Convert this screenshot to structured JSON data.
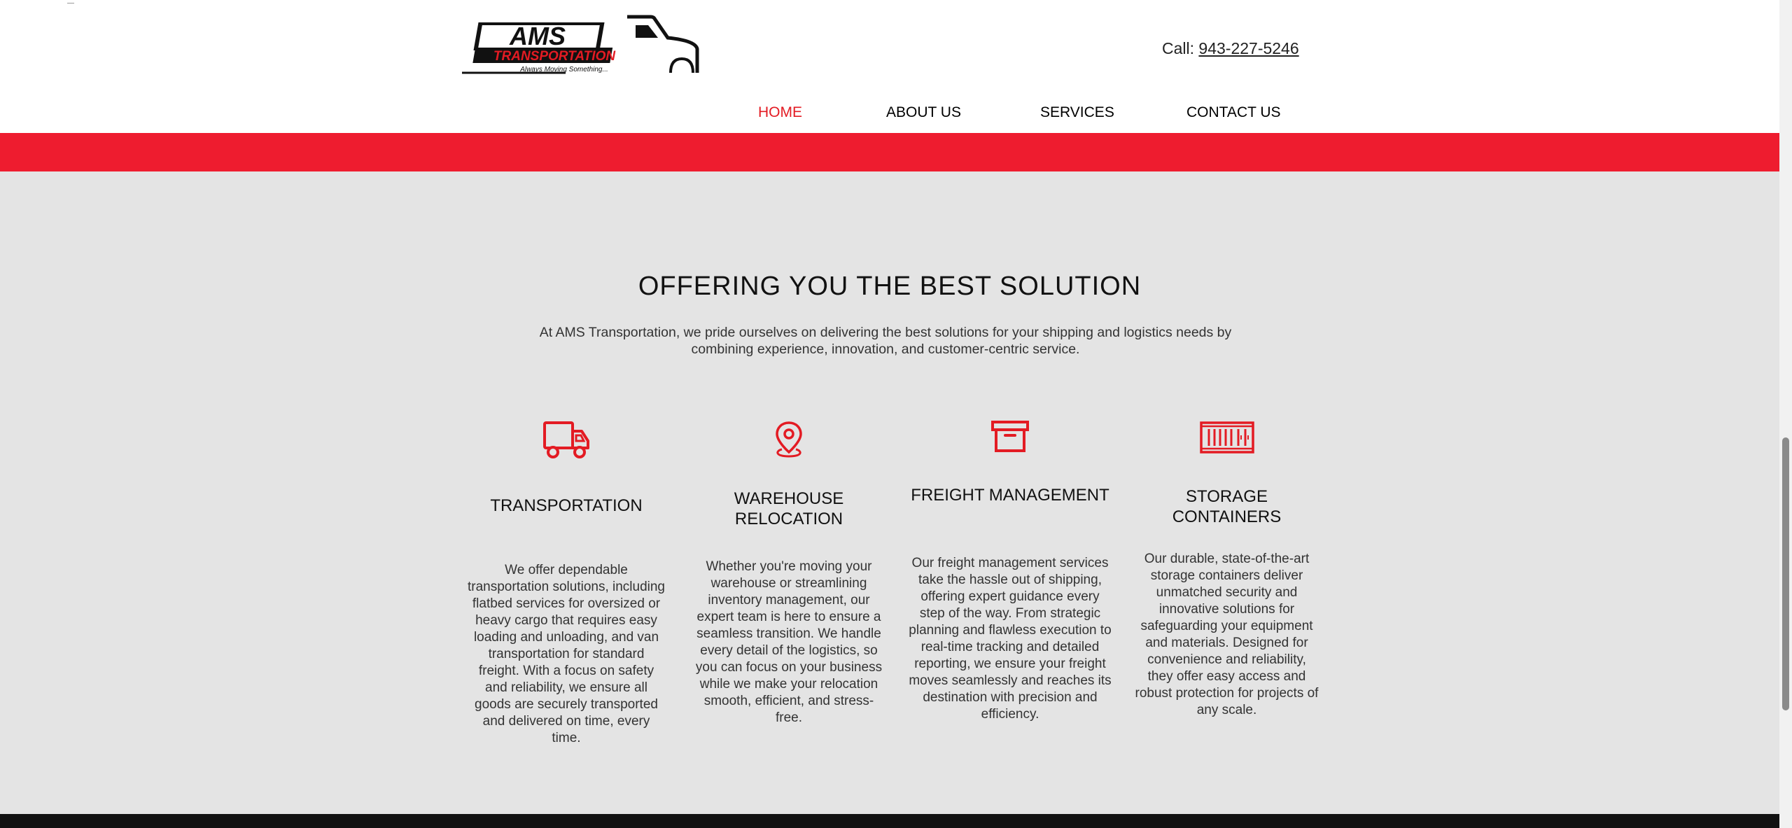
{
  "header": {
    "logo": {
      "brand_text": "AMS",
      "brand_sub": "TRANSPORTATION",
      "tagline": "Always Moving Something..."
    },
    "call_label": "Call: ",
    "phone": "943-227-5246"
  },
  "nav": {
    "items": [
      {
        "label": "HOME",
        "active": true
      },
      {
        "label": "ABOUT US",
        "active": false
      },
      {
        "label": "SERVICES",
        "active": false
      },
      {
        "label": "CONTACT US",
        "active": false
      }
    ]
  },
  "colors": {
    "accent": "#ee1c2f",
    "nav_active": "#e31b23",
    "background": "#e4e4e4"
  },
  "main": {
    "title": "OFFERING YOU THE BEST SOLUTION",
    "intro": "At AMS Transportation, we pride ourselves on delivering the best solutions for your shipping and logistics needs by combining experience, innovation, and customer-centric service.",
    "services": [
      {
        "icon": "truck-icon",
        "title": "TRANSPORTATION",
        "text": "We offer dependable transportation solutions, including flatbed services for oversized or heavy cargo that requires easy loading and unloading, and van transportation for standard freight. With a focus on safety and reliability, we ensure all goods are securely transported and delivered on time, every time."
      },
      {
        "icon": "location-pin-icon",
        "title": "WAREHOUSE RELOCATION",
        "text": "Whether you're moving your warehouse or streamlining inventory management, our expert team is here to ensure a seamless transition. We handle every detail of the logistics, so you can focus on your business while we make your relocation smooth, efficient, and stress-free."
      },
      {
        "icon": "archive-box-icon",
        "title": "FREIGHT MANAGEMENT",
        "text": "Our freight management services take the hassle out of shipping, offering expert guidance every step of the way. From strategic planning and flawless execution to real-time tracking and detailed reporting, we ensure your freight moves seamlessly and reaches its destination with precision and efficiency."
      },
      {
        "icon": "shipping-container-icon",
        "title": "STORAGE CONTAINERS",
        "text": "Our durable, state-of-the-art storage containers deliver unmatched security and innovative solutions for safeguarding your equipment and materials. Designed for convenience and reliability, they offer easy access and robust protection for projects of any scale."
      }
    ]
  }
}
